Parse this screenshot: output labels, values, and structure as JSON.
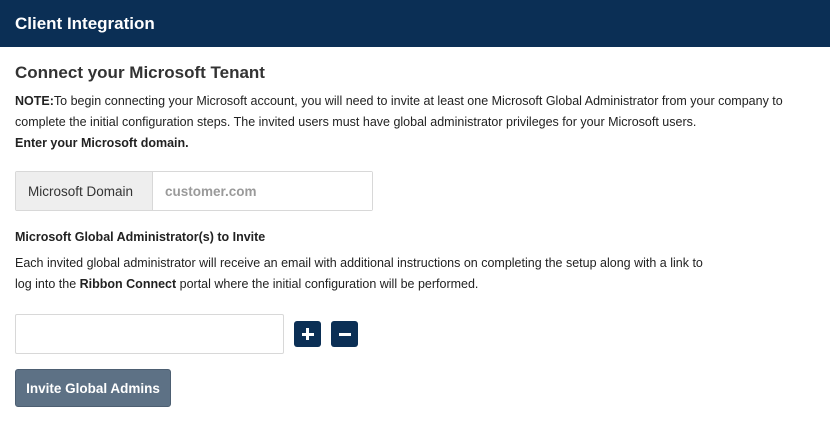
{
  "header": {
    "title": "Client Integration"
  },
  "main": {
    "title": "Connect your Microsoft Tenant",
    "note_label": "NOTE:",
    "note_text": "To begin connecting your Microsoft account, you will need to invite at least one Microsoft Global Administrator from your company to complete the initial configuration steps. The invited users must have global administrator privileges for your Microsoft users.",
    "domain_section_label": "Enter your Microsoft domain.",
    "domain_addon": "Microsoft Domain",
    "domain_placeholder": "customer.com",
    "domain_value": "",
    "admins_section_label": "Microsoft Global Administrator(s) to Invite",
    "admins_desc_part1": "Each invited global administrator will receive an email with additional instructions on completing the setup along with a link to log into the ",
    "admins_desc_brand": "Ribbon Connect",
    "admins_desc_part2": " portal where the initial configuration will be performed.",
    "admin_email_value": "",
    "invite_button_label": "Invite Global Admins"
  },
  "icons": [
    "plus-icon",
    "minus-icon"
  ],
  "colors": {
    "header_bg": "#0b2f55",
    "icon_button_bg": "#0b2f55",
    "invite_button_bg": "#5d7185"
  }
}
